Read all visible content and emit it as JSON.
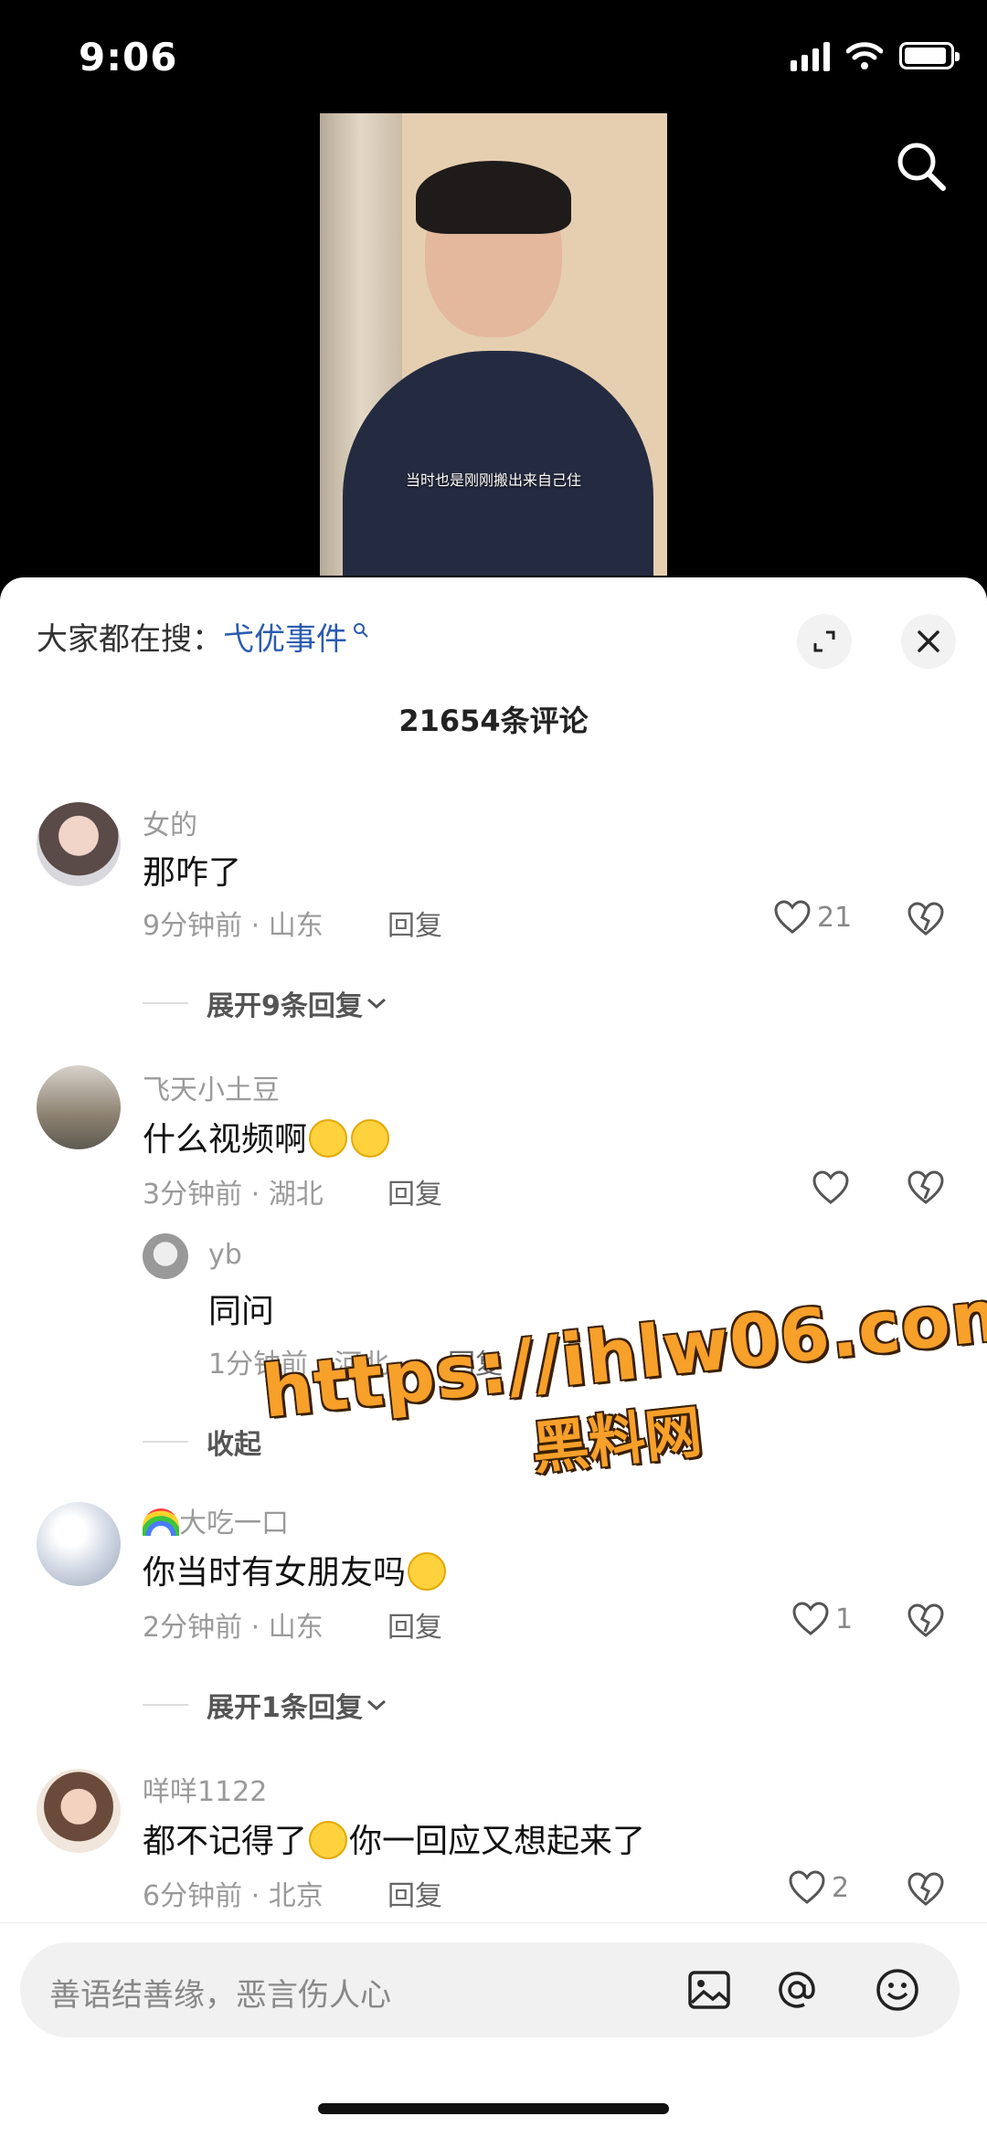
{
  "status_bar": {
    "time": "9:06"
  },
  "video": {
    "caption": "当时也是刚刚搬出来自己住"
  },
  "trending": {
    "prefix": "大家都在搜：",
    "keyword": "弋优事件"
  },
  "comments_header": {
    "title": "21654条评论"
  },
  "comments": [
    {
      "username": "女的",
      "text": "那咋了",
      "meta": "9分钟前 · 山东",
      "reply_label": "回复",
      "likes": "21",
      "expand_label": "展开9条回复"
    },
    {
      "username": "飞天小土豆",
      "text": "什么视频啊",
      "meta": "3分钟前 · 湖北",
      "reply_label": "回复",
      "likes": "",
      "sub_reply": {
        "username": "yb",
        "text": "同问",
        "meta": "1分钟前 · 河北",
        "reply_label": "回复"
      },
      "collapse_label": "收起"
    },
    {
      "username": "大吃一口",
      "text": "你当时有女朋友吗",
      "meta": "2分钟前 · 山东",
      "reply_label": "回复",
      "likes": "1",
      "expand_label": "展开1条回复"
    },
    {
      "username": "咩咩1122",
      "text_before": "都不记得了",
      "text_after": "你一回应又想起来了",
      "meta": "6分钟前 · 北京",
      "reply_label": "回复",
      "likes": "2"
    }
  ],
  "watermark": {
    "line1": "https://ihlw06.com",
    "line2": "黑料网"
  },
  "input": {
    "placeholder": "善语结善缘，恶言伤人心"
  },
  "colors": {
    "keyword": "#2c5bb0",
    "watermark": "#f7a02a",
    "sheet_bg": "#ffffff"
  }
}
